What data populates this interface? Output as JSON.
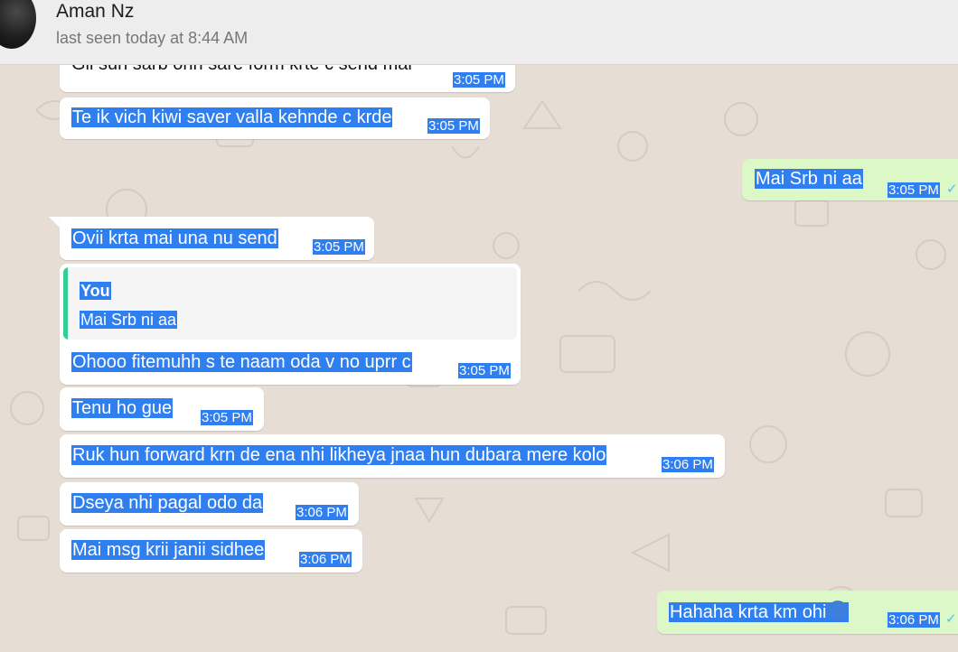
{
  "header": {
    "contact_name": "Aman Nz",
    "status": "last seen today at 8:44 AM"
  },
  "messages": [
    {
      "text": "Gll sun sarb ohh sare form krte c send mai",
      "time": "3:05 PM",
      "direction": "in"
    },
    {
      "text": "Te ik vich kiwi saver valla kehnde c krde",
      "time": "3:05 PM",
      "direction": "in"
    },
    {
      "text": "Mai Srb ni aa",
      "time": "3:05 PM",
      "direction": "out"
    },
    {
      "text": "Ovii krta mai una nu send",
      "time": "3:05 PM",
      "direction": "in"
    },
    {
      "quote_author": "You",
      "quote_text": "Mai Srb ni aa",
      "text": "Ohooo fitemuhh s te naam oda v no uprr c",
      "time": "3:05 PM",
      "direction": "in"
    },
    {
      "text": "Tenu ho gue",
      "time": "3:05 PM",
      "direction": "in"
    },
    {
      "text": "Ruk hun forward krn de ena nhi likheya jnaa hun dubara mere kolo",
      "time": "3:06 PM",
      "direction": "in"
    },
    {
      "text": "Dseya nhi pagal odo da",
      "time": "3:06 PM",
      "direction": "in"
    },
    {
      "text": "Mai msg krii janii sidhee",
      "time": "3:06 PM",
      "direction": "in"
    },
    {
      "text": "Hahaha krta km ohi",
      "time": "3:06 PM",
      "direction": "out",
      "emoji": "rofl-emoji"
    }
  ],
  "colors": {
    "selection": "#2f7ff0",
    "outgoing_bubble": "#dcf8c6",
    "incoming_bubble": "#ffffff",
    "read_ticks": "#4fc3f7"
  }
}
